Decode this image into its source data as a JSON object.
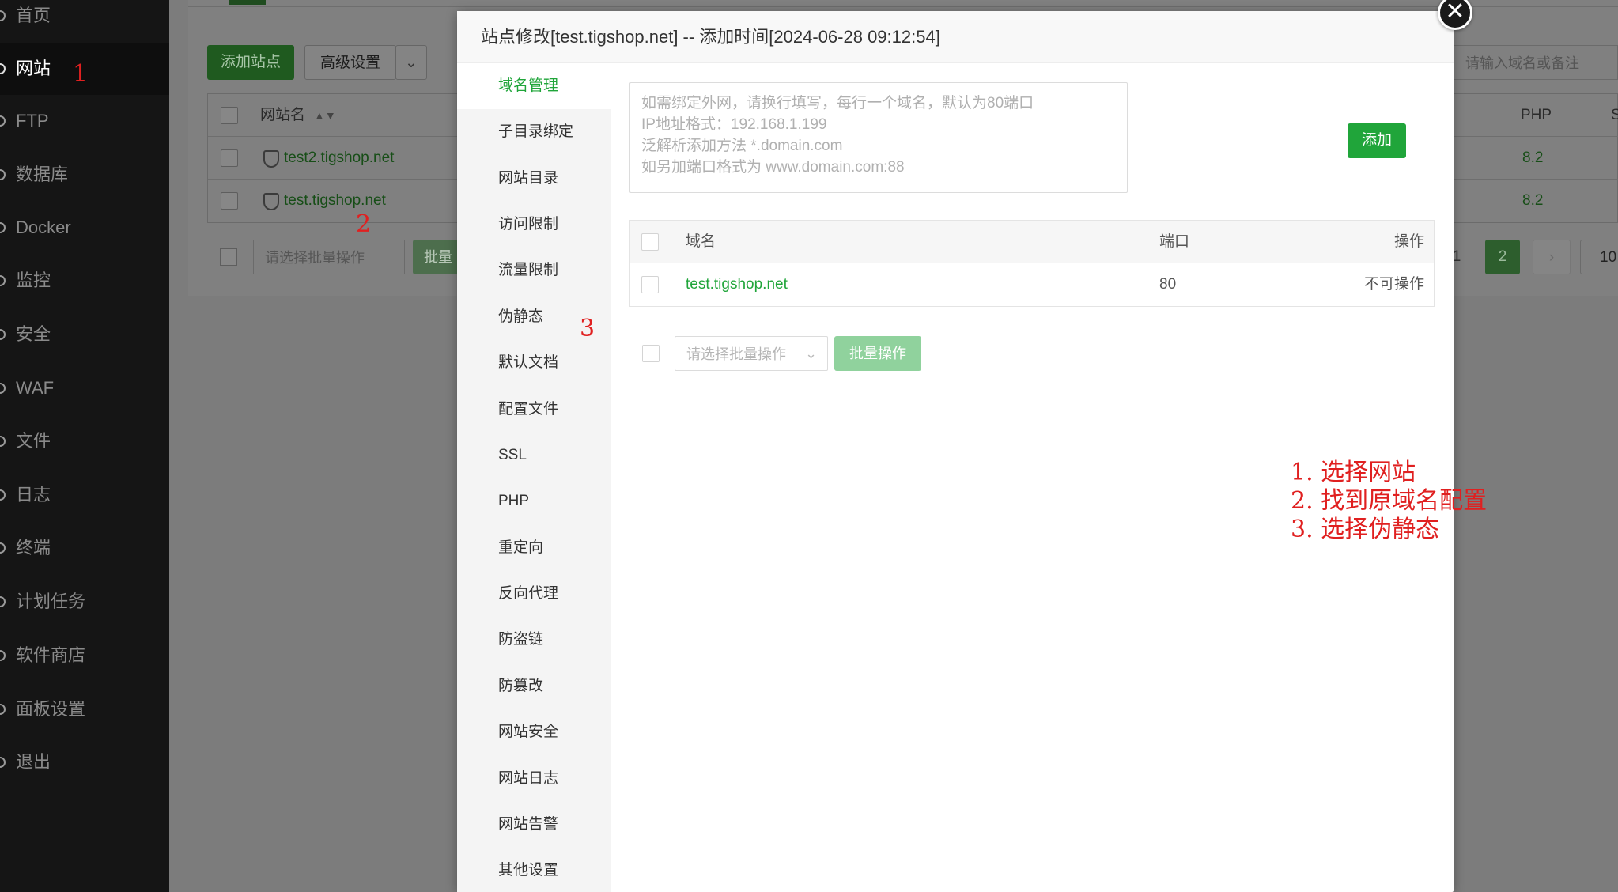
{
  "sidebar": {
    "items": [
      {
        "label": "首页",
        "icon": "home-icon"
      },
      {
        "label": "网站",
        "icon": "globe-icon"
      },
      {
        "label": "FTP",
        "icon": "ftp-icon"
      },
      {
        "label": "数据库",
        "icon": "database-icon"
      },
      {
        "label": "Docker",
        "icon": "docker-icon"
      },
      {
        "label": "监控",
        "icon": "monitor-icon"
      },
      {
        "label": "安全",
        "icon": "shield-icon"
      },
      {
        "label": "WAF",
        "icon": "waf-icon"
      },
      {
        "label": "文件",
        "icon": "folder-icon"
      },
      {
        "label": "日志",
        "icon": "log-icon"
      },
      {
        "label": "终端",
        "icon": "terminal-icon"
      },
      {
        "label": "计划任务",
        "icon": "schedule-icon"
      },
      {
        "label": "软件商店",
        "icon": "store-icon"
      },
      {
        "label": "面板设置",
        "icon": "settings-icon"
      },
      {
        "label": "退出",
        "icon": "logout-icon"
      }
    ],
    "active_index": 1
  },
  "background": {
    "toolbar": {
      "add_site_label": "添加站点",
      "advanced_label": "高级设置",
      "search_placeholder": "请输入域名或备注"
    },
    "table": {
      "columns": {
        "name": "网站名",
        "php": "PHP",
        "tail": "S"
      },
      "rows": [
        {
          "name": "test2.tigshop.net",
          "php": "8.2"
        },
        {
          "name": "test.tigshop.net",
          "php": "8.2"
        }
      ]
    },
    "batch_select_placeholder": "请选择批量操作",
    "batch_button_label": "批量",
    "pagination": {
      "prev_page": "1",
      "current_page": "2",
      "next": "›",
      "page_size": "10"
    }
  },
  "modal": {
    "title": "站点修改[test.tigshop.net] -- 添加时间[2024-06-28 09:12:54]",
    "close_glyph": "✕",
    "menu": [
      "域名管理",
      "子目录绑定",
      "网站目录",
      "访问限制",
      "流量限制",
      "伪静态",
      "默认文档",
      "配置文件",
      "SSL",
      "PHP",
      "重定向",
      "反向代理",
      "防盗链",
      "防篡改",
      "网站安全",
      "网站日志",
      "网站告警",
      "其他设置"
    ],
    "active_menu_index": 0,
    "domain_input_placeholder": [
      "如需绑定外网，请换行填写，每行一个域名，默认为80端口",
      "IP地址格式：192.168.1.199",
      "泛解析添加方法 *.domain.com",
      "如另加端口格式为 www.domain.com:88"
    ],
    "add_button_label": "添加",
    "domain_table": {
      "columns": {
        "domain": "域名",
        "port": "端口",
        "action": "操作"
      },
      "rows": [
        {
          "domain": "test.tigshop.net",
          "port": "80",
          "action": "不可操作"
        }
      ]
    },
    "batch_select_placeholder": "请选择批量操作",
    "batch_button_label": "批量操作"
  },
  "annotations": {
    "step1_marker": "1",
    "step2_marker": "2",
    "step3_marker": "3",
    "notes": [
      "1. 选择网站",
      "2. 找到原域名配置",
      "3. 选择伪静态"
    ]
  },
  "colors": {
    "accent": "#20a53a",
    "annotation": "#e02020"
  }
}
